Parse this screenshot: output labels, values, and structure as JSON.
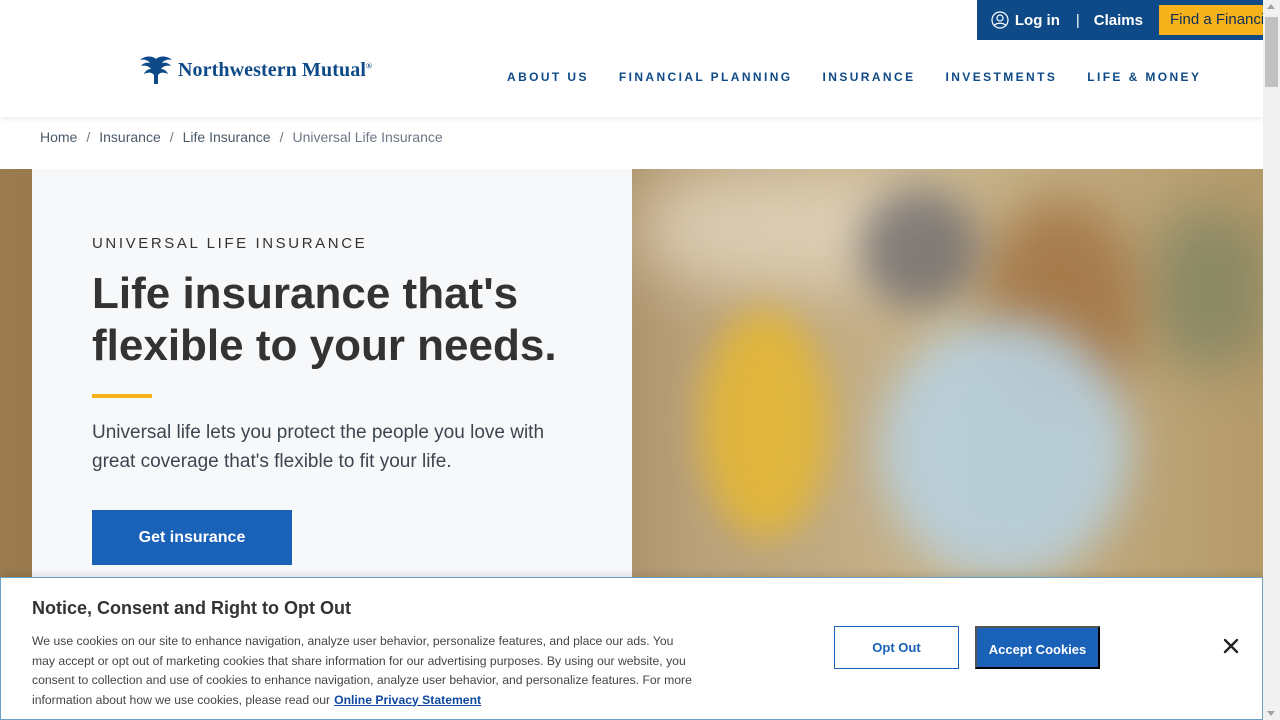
{
  "utility_bar": {
    "login_label": "Log in",
    "separator": "|",
    "claims_label": "Claims",
    "find_advisor_label": "Find a Financial Advisor"
  },
  "logo": {
    "name": "Northwestern Mutual",
    "reg": "®"
  },
  "nav": {
    "items": [
      "ABOUT US",
      "FINANCIAL PLANNING",
      "INSURANCE",
      "INVESTMENTS",
      "LIFE & MONEY"
    ]
  },
  "breadcrumb": {
    "items": [
      "Home",
      "Insurance",
      "Life Insurance"
    ],
    "current": "Universal Life Insurance",
    "separator": "/"
  },
  "hero": {
    "eyebrow": "UNIVERSAL LIFE INSURANCE",
    "headline_line1": "Life insurance that's",
    "headline_line2": "flexible to your needs.",
    "lead": "Universal life lets you protect the people you love with great coverage that's flexible to fit your life.",
    "cta_label": "Get insurance"
  },
  "cookie_banner": {
    "title": "Notice, Consent and Right to Opt Out",
    "body": "We use cookies on our site to enhance navigation, analyze user behavior, personalize features, and place our ads. You may accept or opt out of marketing cookies that share information for our advertising purposes. By using our website, you consent to collection and use of cookies to enhance navigation, analyze user behavior, and personalize features. For more information about how we use cookies, please read our",
    "link_label": "Online Privacy Statement",
    "opt_out_label": "Opt Out",
    "accept_label": "Accept Cookies"
  },
  "colors": {
    "brand_blue": "#0e4a87",
    "cta_blue": "#1a61b8",
    "accent_gold": "#f6b21b"
  },
  "icons": {
    "user": "user-icon",
    "close": "close-icon",
    "logo_mark": "eagle-logo-icon"
  }
}
